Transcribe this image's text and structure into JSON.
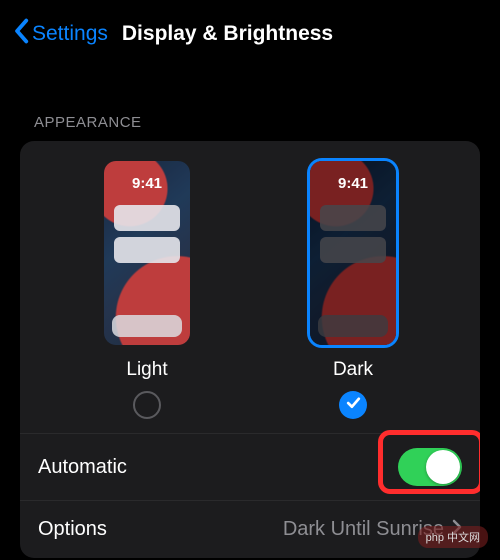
{
  "header": {
    "back": "Settings",
    "title": "Display & Brightness"
  },
  "section_label": "APPEARANCE",
  "thumb_time": "9:41",
  "options": {
    "light": {
      "label": "Light"
    },
    "dark": {
      "label": "Dark"
    }
  },
  "rows": {
    "automatic": {
      "label": "Automatic"
    },
    "options_row": {
      "label": "Options",
      "value": "Dark Until Sunrise"
    }
  },
  "watermark": "php 中文网"
}
